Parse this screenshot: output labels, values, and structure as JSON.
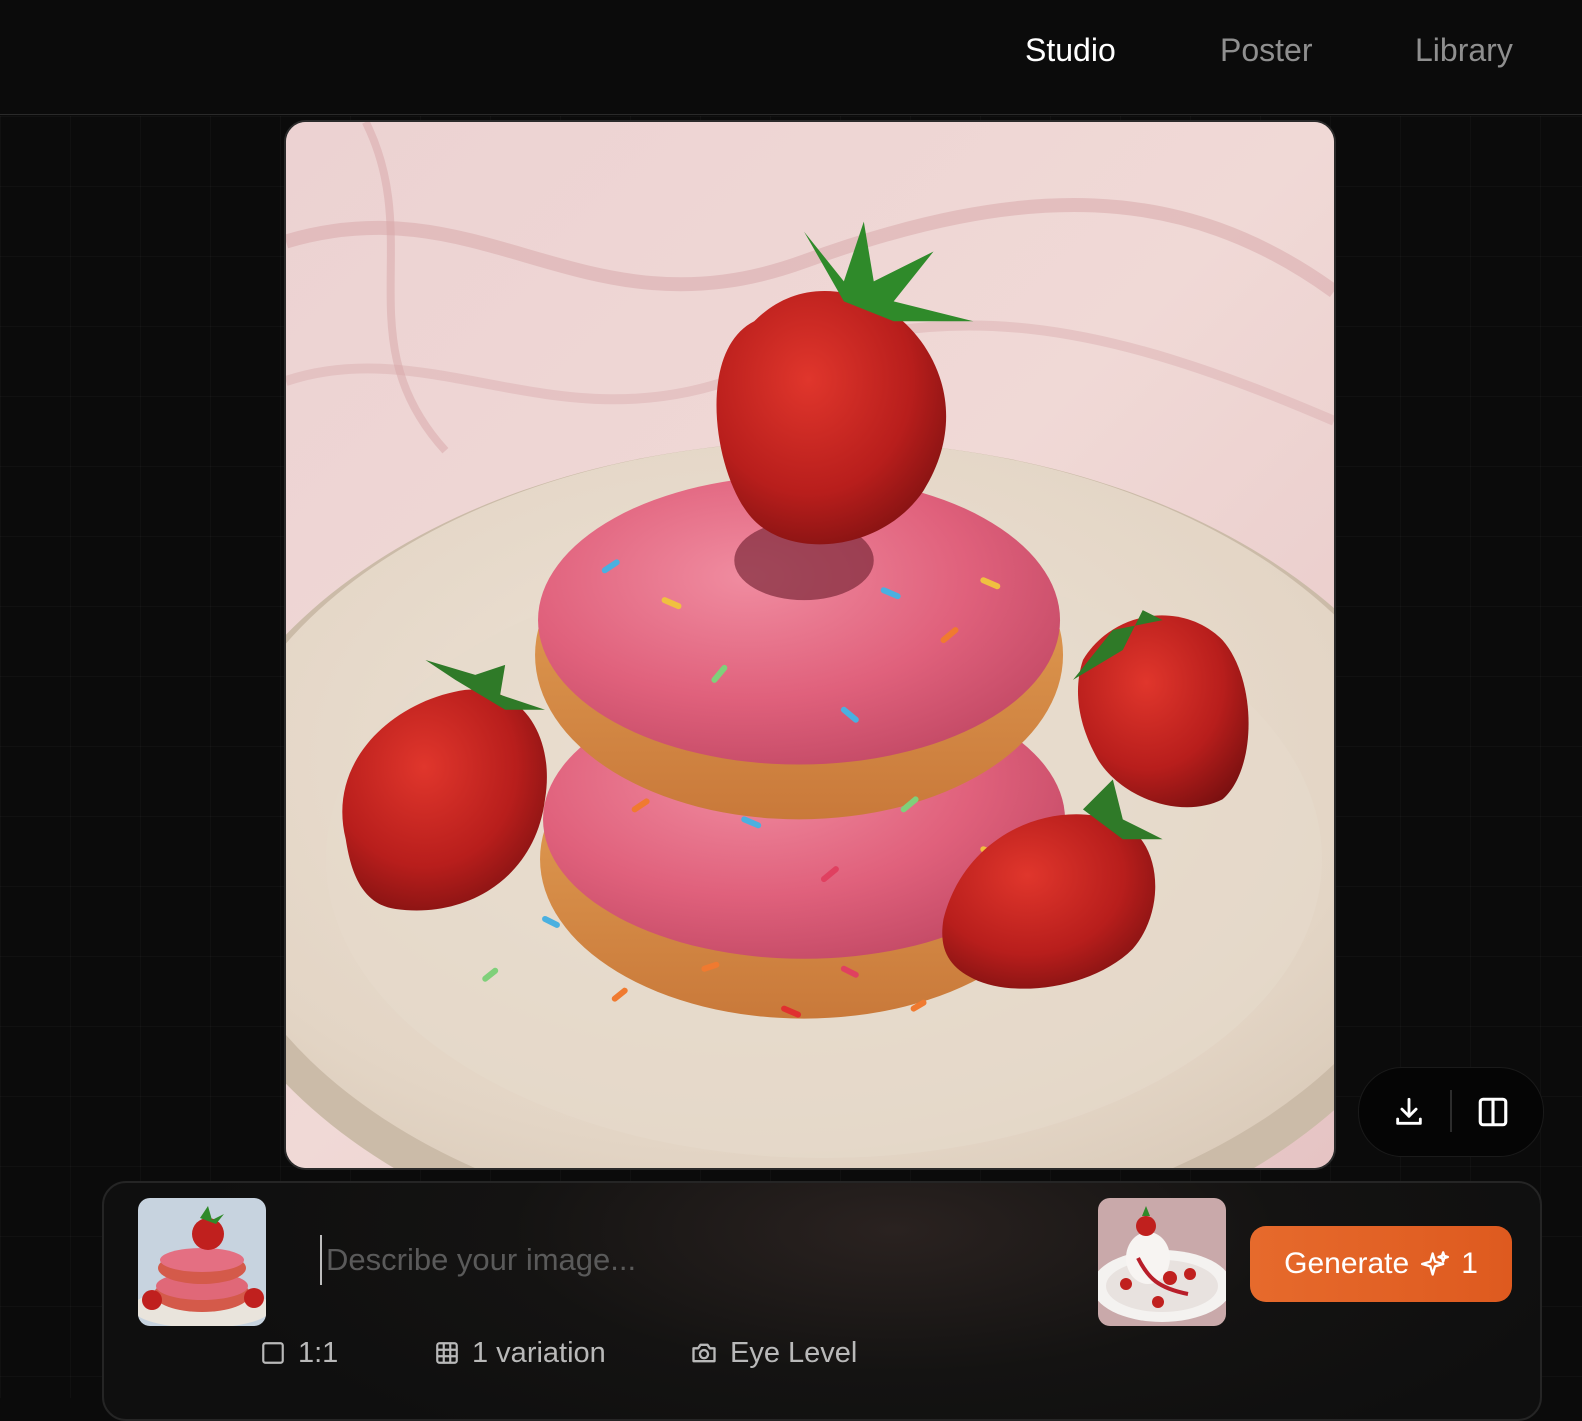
{
  "nav": {
    "tabs": [
      {
        "label": "Studio",
        "active": true
      },
      {
        "label": "Poster",
        "active": false
      },
      {
        "label": "Library",
        "active": false
      }
    ]
  },
  "canvas": {
    "image": "strawberry-frosted-donuts-on-plate"
  },
  "tools": {
    "download_icon": "download-icon",
    "compare_icon": "split-view-icon"
  },
  "prompt": {
    "placeholder": "Describe your image...",
    "value": "",
    "reference_image": "donut-stack-thumbnail",
    "style_image": "strawberry-dessert-thumbnail",
    "generate_label": "Generate",
    "generate_icon": "sparkle-icon",
    "generate_count": "1"
  },
  "options": {
    "ratio": "1:1",
    "variations": "1 variation",
    "camera": "Eye Level"
  },
  "colors": {
    "accent": "#e2622a",
    "background": "#0b0b0b",
    "active_tab": "#ffffff",
    "inactive_tab": "#8f8f8f"
  }
}
